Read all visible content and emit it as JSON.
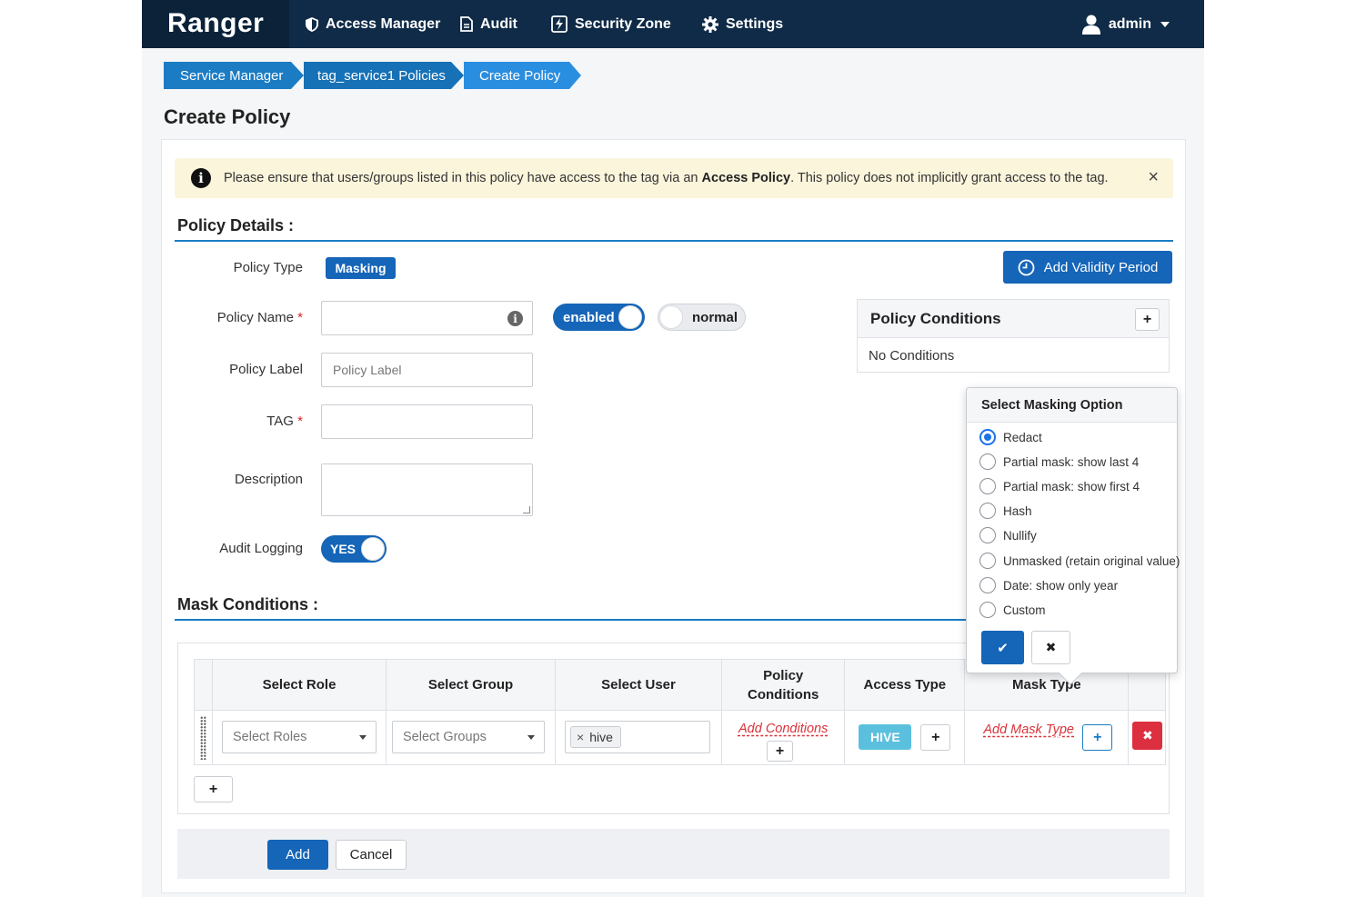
{
  "navbar": {
    "brand": "Ranger",
    "items": [
      {
        "label": "Access Manager",
        "icon": "shield-icon"
      },
      {
        "label": "Audit",
        "icon": "file-icon"
      },
      {
        "label": "Security Zone",
        "icon": "bolt-icon"
      },
      {
        "label": "Settings",
        "icon": "gear-icon"
      }
    ],
    "user": "admin"
  },
  "breadcrumb": [
    "Service Manager",
    "tag_service1 Policies",
    "Create Policy"
  ],
  "page_title": "Create Policy",
  "alert": {
    "text_before": "Please ensure that users/groups listed in this policy have access to the tag via an ",
    "bold": "Access Policy",
    "text_after": ". This policy does not implicitly grant access to the tag.",
    "close": "×"
  },
  "policy_details": {
    "title": "Policy Details :",
    "policy_type_label": "Policy Type",
    "policy_type_value": "Masking",
    "add_validity_label": "Add Validity Period",
    "policy_name_label": "Policy Name",
    "required_mark": "*",
    "enabled_toggle": "enabled",
    "normal_toggle": "normal",
    "policy_label_label": "Policy Label",
    "policy_label_placeholder": "Policy Label",
    "tag_label": "TAG",
    "description_label": "Description",
    "audit_logging_label": "Audit Logging",
    "audit_logging_value": "YES"
  },
  "policy_conditions": {
    "title": "Policy Conditions",
    "add": "+",
    "empty_text": "No Conditions"
  },
  "mask_conditions": {
    "title": "Mask Conditions :",
    "headers": [
      "Select Role",
      "Select Group",
      "Select User",
      "Policy Conditions",
      "Access Type",
      "Mask Type"
    ],
    "row": {
      "roles_placeholder": "Select Roles",
      "groups_placeholder": "Select Groups",
      "user_tag": "hive",
      "user_tag_remove": "×",
      "add_conditions": "Add Conditions",
      "access_type": "HIVE",
      "add_mask_type": "Add Mask Type",
      "plus": "+",
      "delete": "✖"
    },
    "add_row": "+"
  },
  "masking_popover": {
    "title": "Select Masking Option",
    "options": [
      "Redact",
      "Partial mask: show last 4",
      "Partial mask: show first 4",
      "Hash",
      "Nullify",
      "Unmasked (retain original value)",
      "Date: show only year",
      "Custom"
    ],
    "selected": "Redact",
    "confirm": "✔",
    "cancel": "✖"
  },
  "footer": {
    "add": "Add",
    "cancel": "Cancel"
  },
  "colors": {
    "navbar": "#0f2b47",
    "primary": "#1565b8",
    "danger": "#dc2f3f",
    "info": "#5bc0de",
    "alert_bg": "#fbf5dc"
  }
}
